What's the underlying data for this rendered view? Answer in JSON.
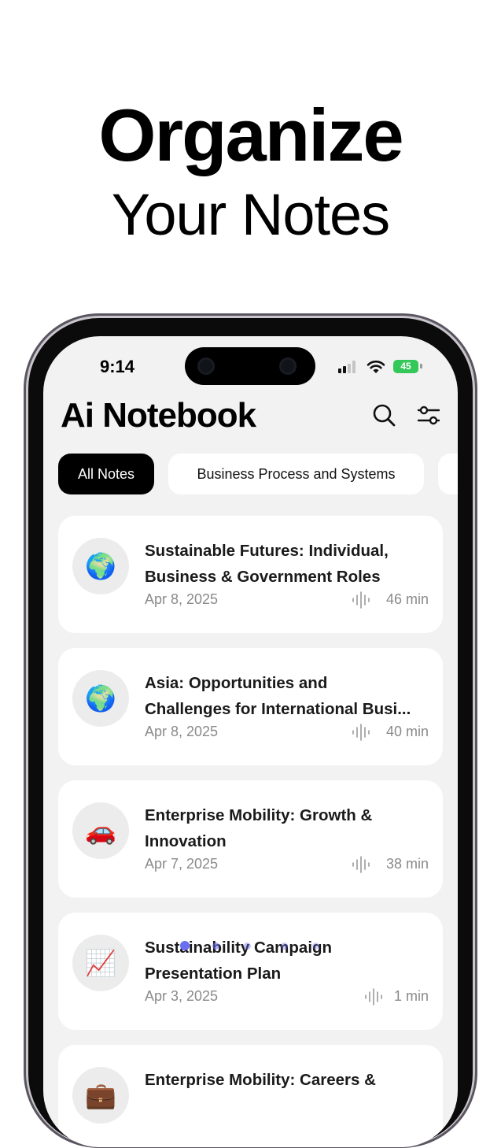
{
  "headline": {
    "line1": "Organize",
    "line2": "Your Notes"
  },
  "status_bar": {
    "time": "9:14",
    "battery": "45"
  },
  "app": {
    "title": "Ai Notebook"
  },
  "icons": {
    "search": "search-icon",
    "filter": "sliders-icon",
    "waveform": "waveform-icon"
  },
  "chips": [
    {
      "label": "All Notes",
      "active": true
    },
    {
      "label": "Business Process and Systems",
      "active": false
    },
    {
      "label": "",
      "active": false
    }
  ],
  "notes": [
    {
      "emoji": "🌍",
      "title": "Sustainable Futures:  Individual,\nBusiness & Government Roles",
      "date": "Apr 8, 2025",
      "duration": "46 min"
    },
    {
      "emoji": "🌍",
      "title": "Asia: Opportunities and\nChallenges for International Busi...",
      "date": "Apr 8, 2025",
      "duration": "40 min"
    },
    {
      "emoji": "🚗",
      "title": "Enterprise Mobility: Growth &\nInnovation",
      "date": "Apr 7, 2025",
      "duration": "38 min"
    },
    {
      "emoji": "📈",
      "title": "Sustainability Campaign\nPresentation Plan",
      "date": "Apr 3, 2025",
      "duration": "1 min"
    },
    {
      "emoji": "💼",
      "title": "Enterprise Mobility: Careers &",
      "date": "",
      "duration": ""
    }
  ],
  "colors": {
    "accent": "#000000",
    "battery": "#34c759",
    "screen_bg": "#f2f2f2",
    "card_bg": "#ffffff"
  }
}
